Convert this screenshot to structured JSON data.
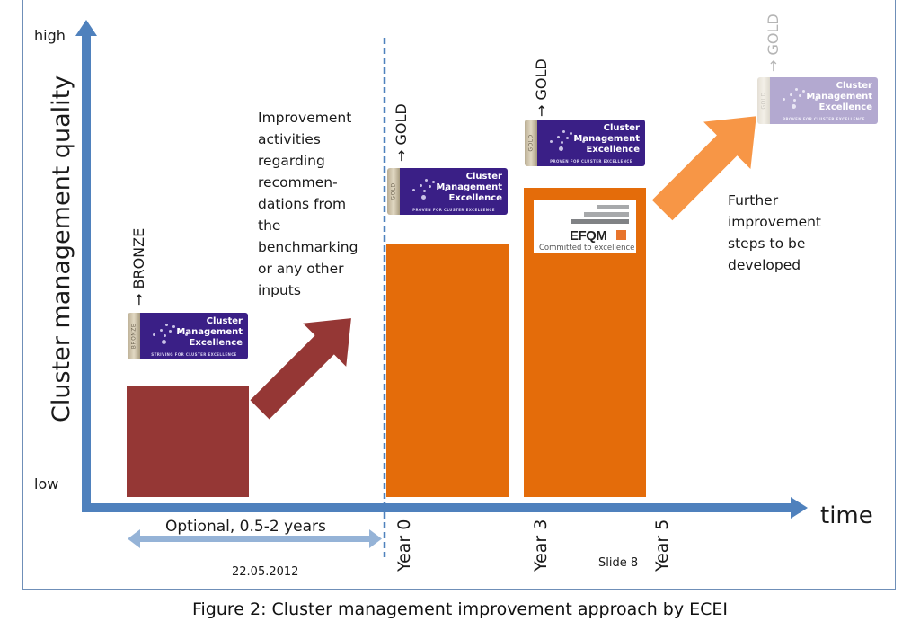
{
  "axes": {
    "y_label": "Cluster management quality",
    "y_high": "high",
    "y_low": "low",
    "x_label": "time"
  },
  "time_ticks": [
    "Year 0",
    "Year 3",
    "Year 5"
  ],
  "optional_span": {
    "label": "Optional, 0.5-2 years"
  },
  "footer": {
    "date": "22.05.2012",
    "slide": "Slide 8"
  },
  "stages": [
    {
      "name": "bronze-stage",
      "level_label": "→ BRONZE",
      "quality_fraction": 0.24,
      "color": "#953735",
      "badge": {
        "strip": "BRONZE",
        "title": [
          "Cluster",
          "Management",
          "Excellence"
        ],
        "tagline": "STRIVING FOR CLUSTER EXCELLENCE"
      }
    },
    {
      "name": "gold-year0",
      "level_label": "→ GOLD",
      "quality_fraction": 0.55,
      "color": "#e46c0a",
      "badge": {
        "strip": "GOLD",
        "title": [
          "Cluster",
          "Management",
          "Excellence"
        ],
        "tagline": "PROVEN FOR CLUSTER EXCELLENCE"
      }
    },
    {
      "name": "gold-year3",
      "level_label": "→ GOLD",
      "quality_fraction": 0.67,
      "color": "#e46c0a",
      "badge": {
        "strip": "GOLD",
        "title": [
          "Cluster",
          "Management",
          "Excellence"
        ],
        "tagline": "PROVEN FOR CLUSTER EXCELLENCE"
      },
      "efqm": {
        "name": "EFQM",
        "tagline": "Committed to excellence"
      }
    },
    {
      "name": "gold-future",
      "level_label": "→ GOLD",
      "color": "#f79646",
      "badge": {
        "strip": "GOLD",
        "title": [
          "Cluster",
          "Management",
          "Excellence"
        ],
        "tagline": "PROVEN FOR CLUSTER EXCELLENCE"
      }
    }
  ],
  "annotations": {
    "improvement": [
      "Improvement",
      "activities",
      "regarding",
      "recommen-",
      "dations from",
      "the",
      "benchmarking",
      "or any other",
      "inputs"
    ],
    "further": [
      "Further",
      "improvement",
      "steps to be",
      "developed"
    ]
  },
  "colors": {
    "axis": "#4f81bd",
    "span_arrow": "#95b3d7",
    "bronze_bar": "#953735",
    "gold_bar": "#e46c0a",
    "future_arrow": "#f79646",
    "badge_purple": "#3a1f86"
  },
  "caption": "Figure 2: Cluster management improvement approach by ECEI"
}
